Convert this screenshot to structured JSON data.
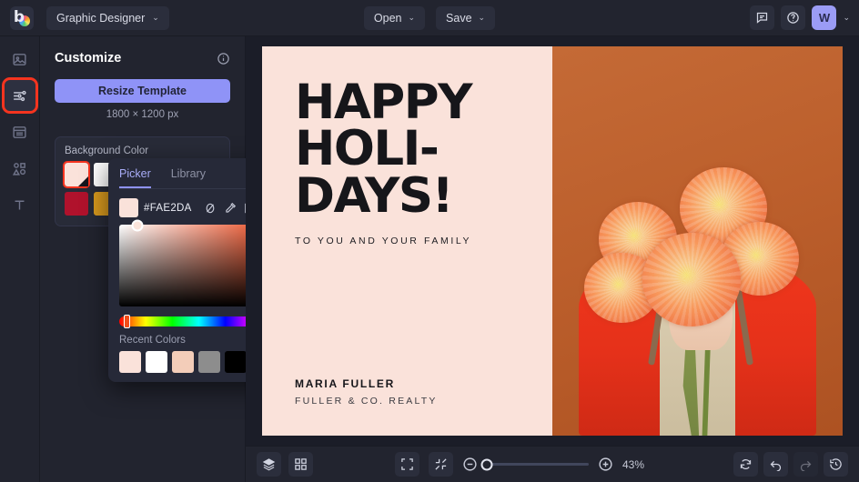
{
  "app": {
    "logo_letter": "b",
    "document_title": "Graphic Designer"
  },
  "topbar": {
    "open_label": "Open",
    "save_label": "Save",
    "chat_icon": "chat-icon",
    "help_icon": "help-icon",
    "avatar_initial": "W",
    "caret": "⌄"
  },
  "rail": {
    "items": [
      {
        "icon": "image-icon",
        "name": "images",
        "selected": false
      },
      {
        "icon": "sliders-icon",
        "name": "customize",
        "selected": true
      },
      {
        "icon": "layout-icon",
        "name": "layouts",
        "selected": false
      },
      {
        "icon": "shapes-icon",
        "name": "shapes",
        "selected": false
      },
      {
        "icon": "text-icon",
        "name": "text",
        "selected": false
      }
    ]
  },
  "panel": {
    "title": "Customize",
    "info_icon": "info-icon",
    "resize_button": "Resize Template",
    "dimensions": "1800 × 1200 px",
    "background_color_label": "Background Color",
    "swatches": [
      {
        "color": "#fae2da",
        "selected": true
      },
      {
        "color": "#ffffff",
        "selected": false
      },
      {
        "color": "#e8451a",
        "selected": false
      },
      {
        "color": "#16161a",
        "selected": false
      },
      {
        "color": "#c99a84",
        "selected": false
      },
      {
        "color": "#b0122c",
        "selected": false
      },
      {
        "color": "#d89a1e",
        "selected": false
      },
      {
        "color": "#3d6b4a",
        "selected": false
      },
      {
        "color": "#5d6a8a",
        "selected": false
      },
      {
        "color": "#8a8f9c",
        "selected": false
      }
    ]
  },
  "picker": {
    "tabs": [
      {
        "label": "Picker",
        "active": true
      },
      {
        "label": "Library",
        "active": false
      }
    ],
    "hex_value": "#FAE2DA",
    "chip_color": "#fae2da",
    "tools": [
      {
        "icon": "no-color-icon",
        "name": "transparent"
      },
      {
        "icon": "eyedropper-icon",
        "name": "eyedropper"
      },
      {
        "icon": "palette-grid-icon",
        "name": "palette"
      },
      {
        "icon": "plus-icon",
        "name": "add-color"
      }
    ],
    "recent_colors_label": "Recent Colors",
    "recent_colors": [
      "#fae2da",
      "#ffffff",
      "#f3cdb9",
      "#8d8d8d",
      "#000000",
      "#ca9d85"
    ]
  },
  "artboard": {
    "background_color": "#fae2da",
    "headline_lines": [
      "HAPPY",
      "HOLI-",
      "DAYS!"
    ],
    "subheading": "TO YOU AND YOUR FAMILY",
    "signature_name": "MARIA FULLER",
    "signature_company": "FULLER & CO. REALTY",
    "photo_alt": "person-holding-flowers"
  },
  "bottombar": {
    "layers_icon": "layers-icon",
    "grid_icon": "grid-icon",
    "fit_icon": "fit-to-screen-icon",
    "shrink_icon": "shrink-icon",
    "zoom_out_icon": "zoom-out-icon",
    "zoom_in_icon": "zoom-in-icon",
    "zoom_percent": "43%",
    "refresh_icon": "refresh-icon",
    "undo_icon": "undo-icon",
    "redo_icon": "redo-icon",
    "history_icon": "history-icon"
  }
}
